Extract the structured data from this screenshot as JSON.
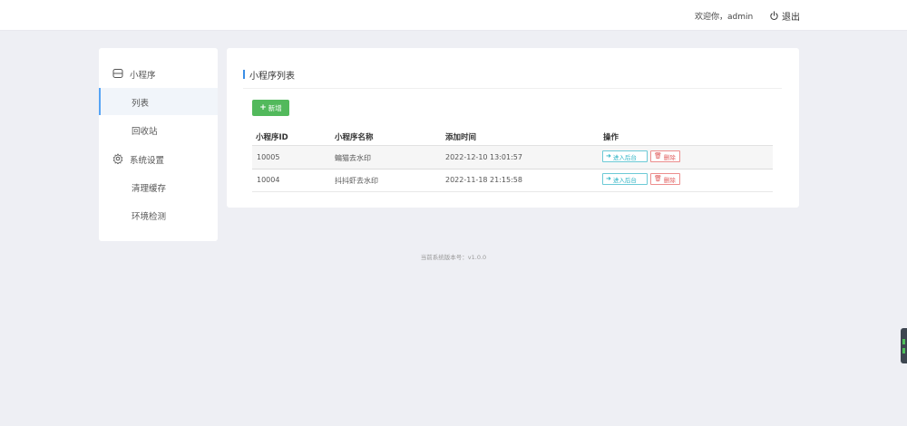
{
  "header": {
    "welcome": "欢迎你，admin",
    "logout_label": "退出",
    "logout_icon": "power-icon"
  },
  "sidebar": {
    "groups": [
      {
        "label": "小程序",
        "icon": "mini-program-icon",
        "items": [
          {
            "label": "列表",
            "active": true
          },
          {
            "label": "回收站",
            "active": false
          }
        ]
      },
      {
        "label": "系统设置",
        "icon": "gear-icon",
        "items": [
          {
            "label": "清理缓存",
            "active": false
          },
          {
            "label": "环境检测",
            "active": false
          }
        ]
      }
    ]
  },
  "main": {
    "title": "小程序列表",
    "add_button": {
      "label": "新增",
      "icon": "plus-icon",
      "color": "#52b95c"
    },
    "table": {
      "headers": [
        "小程序ID",
        "小程序名称",
        "添加时间",
        "操作"
      ],
      "rows": [
        {
          "id": "10005",
          "name": "蝙猫去水印",
          "time": "2022-12-10 13:01:57",
          "enter": "进入后台",
          "delete": "删除"
        },
        {
          "id": "10004",
          "name": "抖抖虾去水印",
          "time": "2022-11-18 21:15:58",
          "enter": "进入后台",
          "delete": "删除"
        }
      ]
    }
  },
  "footer": {
    "version_text": "当前系统版本号：v1.0.0"
  },
  "colors": {
    "accent": "#3a8ee6",
    "active_bar": "#56a4f5",
    "enter_button": "#2bb3c4",
    "delete_button": "#e05c5c",
    "page_background": "#eeeff4"
  }
}
